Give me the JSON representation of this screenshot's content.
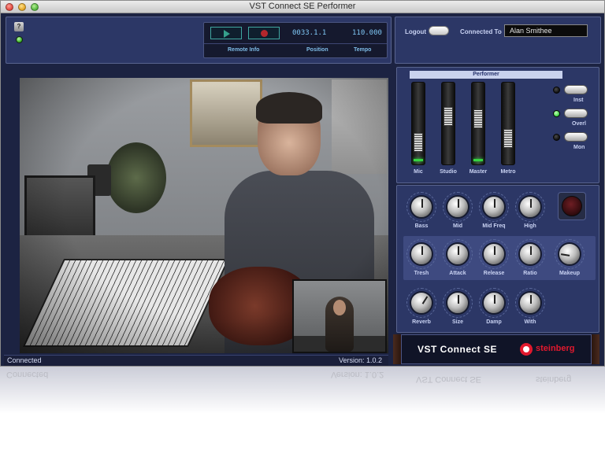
{
  "window": {
    "title": "VST Connect SE Performer"
  },
  "help": {
    "label": "?"
  },
  "transport": {
    "position": "0033.1.1",
    "tempo": "110.000",
    "labels": {
      "remote": "Remote Info",
      "position": "Position",
      "tempo": "Tempo"
    }
  },
  "login": {
    "logout_label": "Logout",
    "connected_to_label": "Connected To",
    "user": "Alan Smithee"
  },
  "status": {
    "left": "Connected",
    "right": "Version: 1.0.2"
  },
  "performer": {
    "title": "Performer",
    "faders": [
      {
        "label": "Mic",
        "level": 0.18
      },
      {
        "label": "Studio",
        "level": 0.62
      },
      {
        "label": "Master",
        "level": 0.58
      },
      {
        "label": "Metro",
        "level": 0.25
      }
    ],
    "switches": [
      {
        "label": "Inst",
        "led_on": false
      },
      {
        "label": "Overl",
        "led_on": true
      },
      {
        "label": "Mon",
        "led_on": false
      }
    ]
  },
  "fx": {
    "eq": [
      {
        "label": "Bass",
        "value": 0.5
      },
      {
        "label": "Mid",
        "value": 0.5
      },
      {
        "label": "Mid Freq",
        "value": 0.5
      },
      {
        "label": "High",
        "value": 0.5
      }
    ],
    "comp": [
      {
        "label": "Tresh",
        "value": 0.5
      },
      {
        "label": "Attack",
        "value": 0.5
      },
      {
        "label": "Release",
        "value": 0.5
      },
      {
        "label": "Ratio",
        "value": 0.5
      },
      {
        "label": "Makeup",
        "value": 0.2
      }
    ],
    "reverb": [
      {
        "label": "Reverb",
        "value": 0.62
      },
      {
        "label": "Size",
        "value": 0.5
      },
      {
        "label": "Damp",
        "value": 0.5
      },
      {
        "label": "With",
        "value": 0.5
      }
    ]
  },
  "brand": {
    "product": "VST Connect SE",
    "company": "steinberg"
  },
  "colors": {
    "panel": "#2c3766",
    "accent_green": "#36d441",
    "brand_red": "#e1192e"
  }
}
